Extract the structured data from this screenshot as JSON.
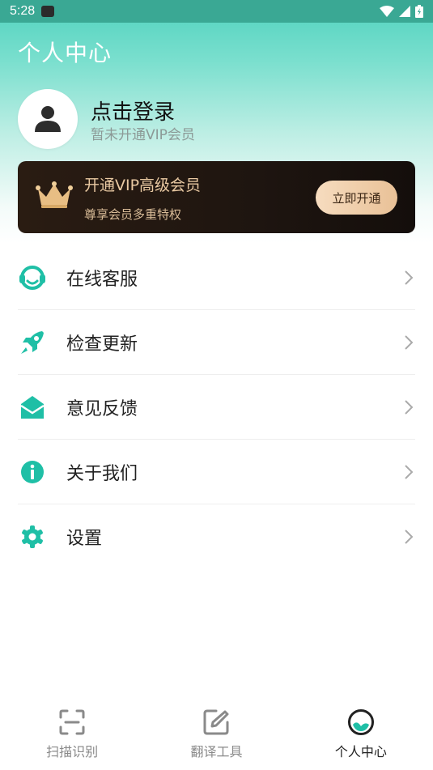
{
  "status_bar": {
    "time": "5:28"
  },
  "header": {
    "title": "个人中心"
  },
  "profile": {
    "login_text": "点击登录",
    "vip_status": "暂未开通VIP会员"
  },
  "vip_card": {
    "title": "开通VIP高级会员",
    "subtitle": "尊享会员多重特权",
    "button_label": "立即开通"
  },
  "menu": {
    "items": [
      {
        "label": "在线客服",
        "icon": "headset-icon"
      },
      {
        "label": "检查更新",
        "icon": "rocket-icon"
      },
      {
        "label": "意见反馈",
        "icon": "envelope-icon"
      },
      {
        "label": "关于我们",
        "icon": "info-icon"
      },
      {
        "label": "设置",
        "icon": "gear-icon"
      }
    ]
  },
  "bottom_nav": {
    "items": [
      {
        "label": "扫描识别",
        "icon": "scan-icon",
        "active": false
      },
      {
        "label": "翻译工具",
        "icon": "edit-icon",
        "active": false
      },
      {
        "label": "个人中心",
        "icon": "profile-icon",
        "active": true
      }
    ]
  },
  "colors": {
    "accent": "#1fbfa6",
    "vip_gold": "#e9c9a2",
    "vip_bg": "#1e1510"
  }
}
